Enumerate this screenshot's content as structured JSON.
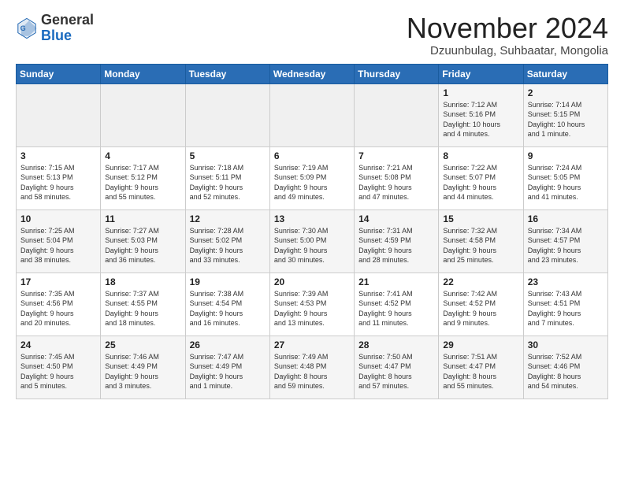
{
  "logo": {
    "general": "General",
    "blue": "Blue"
  },
  "header": {
    "month": "November 2024",
    "location": "Dzuunbulag, Suhbaatar, Mongolia"
  },
  "days_header": [
    "Sunday",
    "Monday",
    "Tuesday",
    "Wednesday",
    "Thursday",
    "Friday",
    "Saturday"
  ],
  "weeks": [
    [
      {
        "day": "",
        "info": ""
      },
      {
        "day": "",
        "info": ""
      },
      {
        "day": "",
        "info": ""
      },
      {
        "day": "",
        "info": ""
      },
      {
        "day": "",
        "info": ""
      },
      {
        "day": "1",
        "info": "Sunrise: 7:12 AM\nSunset: 5:16 PM\nDaylight: 10 hours\nand 4 minutes."
      },
      {
        "day": "2",
        "info": "Sunrise: 7:14 AM\nSunset: 5:15 PM\nDaylight: 10 hours\nand 1 minute."
      }
    ],
    [
      {
        "day": "3",
        "info": "Sunrise: 7:15 AM\nSunset: 5:13 PM\nDaylight: 9 hours\nand 58 minutes."
      },
      {
        "day": "4",
        "info": "Sunrise: 7:17 AM\nSunset: 5:12 PM\nDaylight: 9 hours\nand 55 minutes."
      },
      {
        "day": "5",
        "info": "Sunrise: 7:18 AM\nSunset: 5:11 PM\nDaylight: 9 hours\nand 52 minutes."
      },
      {
        "day": "6",
        "info": "Sunrise: 7:19 AM\nSunset: 5:09 PM\nDaylight: 9 hours\nand 49 minutes."
      },
      {
        "day": "7",
        "info": "Sunrise: 7:21 AM\nSunset: 5:08 PM\nDaylight: 9 hours\nand 47 minutes."
      },
      {
        "day": "8",
        "info": "Sunrise: 7:22 AM\nSunset: 5:07 PM\nDaylight: 9 hours\nand 44 minutes."
      },
      {
        "day": "9",
        "info": "Sunrise: 7:24 AM\nSunset: 5:05 PM\nDaylight: 9 hours\nand 41 minutes."
      }
    ],
    [
      {
        "day": "10",
        "info": "Sunrise: 7:25 AM\nSunset: 5:04 PM\nDaylight: 9 hours\nand 38 minutes."
      },
      {
        "day": "11",
        "info": "Sunrise: 7:27 AM\nSunset: 5:03 PM\nDaylight: 9 hours\nand 36 minutes."
      },
      {
        "day": "12",
        "info": "Sunrise: 7:28 AM\nSunset: 5:02 PM\nDaylight: 9 hours\nand 33 minutes."
      },
      {
        "day": "13",
        "info": "Sunrise: 7:30 AM\nSunset: 5:00 PM\nDaylight: 9 hours\nand 30 minutes."
      },
      {
        "day": "14",
        "info": "Sunrise: 7:31 AM\nSunset: 4:59 PM\nDaylight: 9 hours\nand 28 minutes."
      },
      {
        "day": "15",
        "info": "Sunrise: 7:32 AM\nSunset: 4:58 PM\nDaylight: 9 hours\nand 25 minutes."
      },
      {
        "day": "16",
        "info": "Sunrise: 7:34 AM\nSunset: 4:57 PM\nDaylight: 9 hours\nand 23 minutes."
      }
    ],
    [
      {
        "day": "17",
        "info": "Sunrise: 7:35 AM\nSunset: 4:56 PM\nDaylight: 9 hours\nand 20 minutes."
      },
      {
        "day": "18",
        "info": "Sunrise: 7:37 AM\nSunset: 4:55 PM\nDaylight: 9 hours\nand 18 minutes."
      },
      {
        "day": "19",
        "info": "Sunrise: 7:38 AM\nSunset: 4:54 PM\nDaylight: 9 hours\nand 16 minutes."
      },
      {
        "day": "20",
        "info": "Sunrise: 7:39 AM\nSunset: 4:53 PM\nDaylight: 9 hours\nand 13 minutes."
      },
      {
        "day": "21",
        "info": "Sunrise: 7:41 AM\nSunset: 4:52 PM\nDaylight: 9 hours\nand 11 minutes."
      },
      {
        "day": "22",
        "info": "Sunrise: 7:42 AM\nSunset: 4:52 PM\nDaylight: 9 hours\nand 9 minutes."
      },
      {
        "day": "23",
        "info": "Sunrise: 7:43 AM\nSunset: 4:51 PM\nDaylight: 9 hours\nand 7 minutes."
      }
    ],
    [
      {
        "day": "24",
        "info": "Sunrise: 7:45 AM\nSunset: 4:50 PM\nDaylight: 9 hours\nand 5 minutes."
      },
      {
        "day": "25",
        "info": "Sunrise: 7:46 AM\nSunset: 4:49 PM\nDaylight: 9 hours\nand 3 minutes."
      },
      {
        "day": "26",
        "info": "Sunrise: 7:47 AM\nSunset: 4:49 PM\nDaylight: 9 hours\nand 1 minute."
      },
      {
        "day": "27",
        "info": "Sunrise: 7:49 AM\nSunset: 4:48 PM\nDaylight: 8 hours\nand 59 minutes."
      },
      {
        "day": "28",
        "info": "Sunrise: 7:50 AM\nSunset: 4:47 PM\nDaylight: 8 hours\nand 57 minutes."
      },
      {
        "day": "29",
        "info": "Sunrise: 7:51 AM\nSunset: 4:47 PM\nDaylight: 8 hours\nand 55 minutes."
      },
      {
        "day": "30",
        "info": "Sunrise: 7:52 AM\nSunset: 4:46 PM\nDaylight: 8 hours\nand 54 minutes."
      }
    ]
  ]
}
